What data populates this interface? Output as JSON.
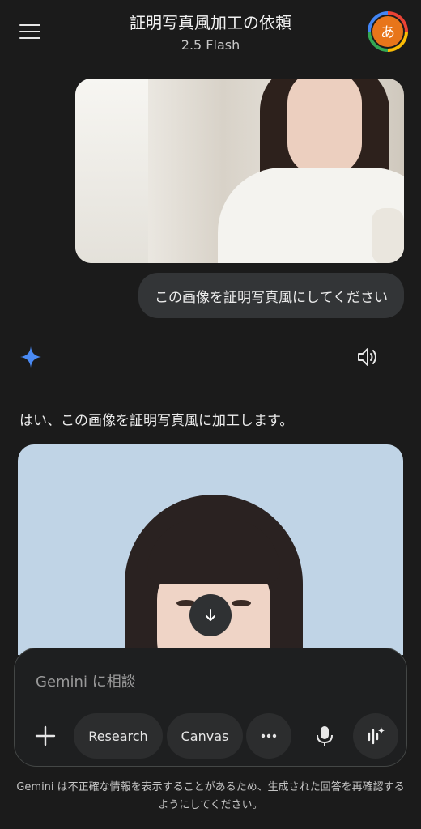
{
  "header": {
    "title": "証明写真風加工の依頼",
    "model": "2.5 Flash",
    "avatar_initial": "あ"
  },
  "conversation": {
    "user_message": "この画像を証明写真風にしてください",
    "assistant_reply": "はい、この画像を証明写真風に加工します。"
  },
  "composer": {
    "placeholder": "Gemini に相談",
    "research_label": "Research",
    "canvas_label": "Canvas"
  },
  "footer": {
    "disclaimer": "Gemini は不正確な情報を表示することがあるため、生成された回答を再確認するようにしてください。"
  },
  "colors": {
    "background": "#1b1b1b",
    "bubble": "#333537",
    "avatar": "#e8751a",
    "spark": "#4285f4"
  }
}
